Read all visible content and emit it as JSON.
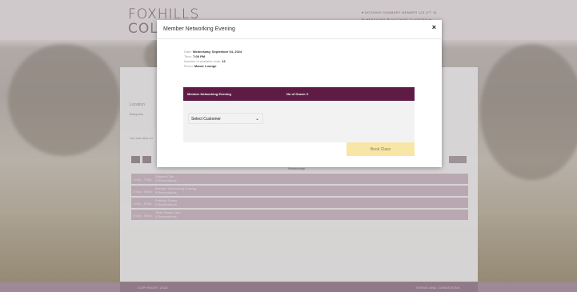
{
  "header": {
    "logo_line1": "FOXHILLS",
    "logo_line2": "COLLE",
    "top_link1": "♥ BOOKING SUMMARY   MEMBER 123 (YT. 8)",
    "top_link2": "✉ MESSAGES   ⚙ ACCOUNT   ⎋ LOGOUT ▾"
  },
  "page": {
    "section_label": "Location",
    "field_label": "Banquets",
    "hint_text": "You can click on",
    "date_line": "Wednesday",
    "events": [
      {
        "time": "7:00p - 7:00p",
        "name": "Original Club",
        "sub": "0 Reservations"
      },
      {
        "time": "7:00p - 9:00p",
        "name": "Member Networking Evening",
        "sub": "0 Reservations"
      },
      {
        "time": "7:00p - 8:00p",
        "name": "Portfolio Drinks",
        "sub": "0 Reservations"
      },
      {
        "time": "7:00p - 8:00p",
        "name": "Table Tennis Club",
        "sub": "0 Reservations"
      }
    ]
  },
  "modal": {
    "title": "Member Networking Evening",
    "close": "×",
    "info": {
      "date_label": "Date:",
      "date_value": "Wednesday, September 04, 2024",
      "time_label": "Time:",
      "time_value": "7:00 PM",
      "slots_label": "Number of available slots:",
      "slots_value": "13",
      "room_label": "Room:",
      "room_value": "Manor Lounge"
    },
    "panel": {
      "event_name": "Member Networking Evening",
      "guest_label": "No of Guest: 0"
    },
    "select": {
      "value": "Select Customer",
      "chevron": "⌄"
    },
    "book_button": "Book Class"
  },
  "footer": {
    "left": "COPYRIGHT 2024",
    "right": "TERMS AND CONDITIONS"
  },
  "colors": {
    "accent": "#5e1c45",
    "book_button": "#f7e6a6",
    "event_rows": "#d9c7d2"
  }
}
